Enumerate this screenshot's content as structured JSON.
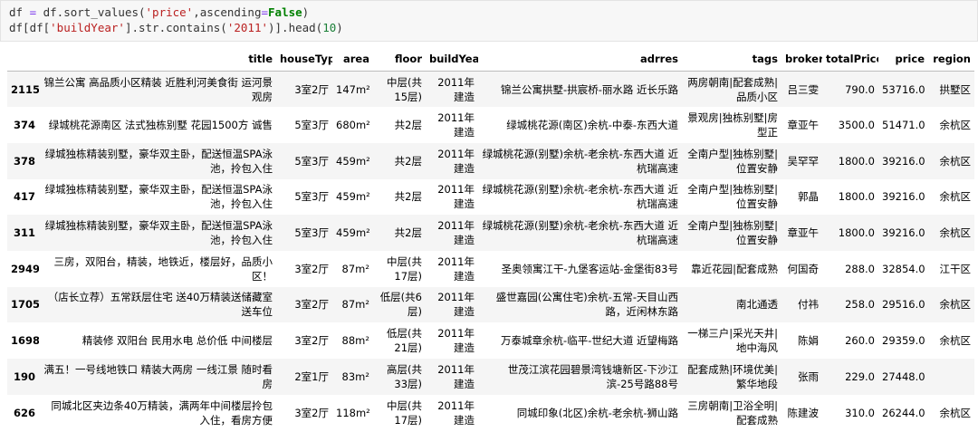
{
  "code": {
    "line1": "df = df.sort_values('price',ascending=False)",
    "line2": "df[df['buildYear'].str.contains('2011')].head(10)"
  },
  "table": {
    "columns": [
      "",
      "title",
      "houseType",
      "area",
      "floor",
      "buildYear",
      "adrres",
      "tags",
      "broker",
      "totalPrice",
      "price",
      "region"
    ],
    "rows": [
      [
        "2115",
        "锦兰公寓 高品质小区精装 近胜利河美食街 运河景观房",
        "3室2厅",
        "147m²",
        "中层(共15层)",
        "2011年建造",
        "锦兰公寓拱墅-拱宸桥-丽水路 近长乐路",
        "两房朝南|配套成熟|品质小区",
        "吕三雯",
        "790.0",
        "53716.0",
        "拱墅区"
      ],
      [
        "374",
        "绿城桃花源南区 法式独栋别墅 花园1500方 诚售",
        "5室3厅",
        "680m²",
        "共2层",
        "2011年建造",
        "绿城桃花源(南区)余杭-中泰-东西大道",
        "景观房|独栋别墅|房型正",
        "章亚午",
        "3500.0",
        "51471.0",
        "余杭区"
      ],
      [
        "378",
        "绿城独栋精装别墅，豪华双主卧，配送恒温SPA泳池，拎包入住",
        "5室3厅",
        "459m²",
        "共2层",
        "2011年建造",
        "绿城桃花源(别墅)余杭-老余杭-东西大道 近杭瑞高速",
        "全南户型|独栋别墅|位置安静",
        "吴罕罕",
        "1800.0",
        "39216.0",
        "余杭区"
      ],
      [
        "417",
        "绿城独栋精装别墅，豪华双主卧，配送恒温SPA泳池，拎包入住",
        "5室3厅",
        "459m²",
        "共2层",
        "2011年建造",
        "绿城桃花源(别墅)余杭-老余杭-东西大道 近杭瑞高速",
        "全南户型|独栋别墅|位置安静",
        "郭晶",
        "1800.0",
        "39216.0",
        "余杭区"
      ],
      [
        "311",
        "绿城独栋精装别墅，豪华双主卧，配送恒温SPA泳池，拎包入住",
        "5室3厅",
        "459m²",
        "共2层",
        "2011年建造",
        "绿城桃花源(别墅)余杭-老余杭-东西大道 近杭瑞高速",
        "全南户型|独栋别墅|位置安静",
        "章亚午",
        "1800.0",
        "39216.0",
        "余杭区"
      ],
      [
        "2949",
        "三房，双阳台，精装，地铁近，楼层好，品质小区！",
        "3室2厅",
        "87m²",
        "中层(共17层)",
        "2011年建造",
        "圣奥领寓江干-九堡客运站-金堡街83号",
        "靠近花园|配套成熟",
        "何国奇",
        "288.0",
        "32854.0",
        "江干区"
      ],
      [
        "1705",
        "（店长立荐）五常跃层住宅 送40万精装送储藏室送车位",
        "3室2厅",
        "87m²",
        "低层(共6层)",
        "2011年建造",
        "盛世嘉园(公寓住宅)余杭-五常-天目山西路，近闲林东路",
        "南北通透",
        "付祎",
        "258.0",
        "29516.0",
        "余杭区"
      ],
      [
        "1698",
        "精装修 双阳台 民用水电 总价低 中间楼层",
        "3室2厅",
        "88m²",
        "低层(共21层)",
        "2011年建造",
        "万泰城章余杭-临平-世纪大道 近望梅路",
        "一梯三户|采光天井|地中海风",
        "陈娟",
        "260.0",
        "29359.0",
        "余杭区"
      ],
      [
        "190",
        "满五！一号线地铁口 精装大两房 一线江景 随时看房",
        "2室1厅",
        "83m²",
        "高层(共33层)",
        "2011年建造",
        "世茂江滨花园碧景湾钱塘新区-下沙江滨-25号路88号",
        "配套成熟|环境优美|繁华地段",
        "张雨",
        "229.0",
        "27448.0",
        ""
      ],
      [
        "626",
        "同城北区夹边条40万精装，满两年中间楼层拎包入住，看房方便",
        "3室2厅",
        "118m²",
        "中层(共17层)",
        "2011年建造",
        "同城印象(北区)余杭-老余杭-狮山路",
        "三房朝南|卫浴全明|配套成熟",
        "陈建波",
        "310.0",
        "26244.0",
        "余杭区"
      ]
    ]
  }
}
